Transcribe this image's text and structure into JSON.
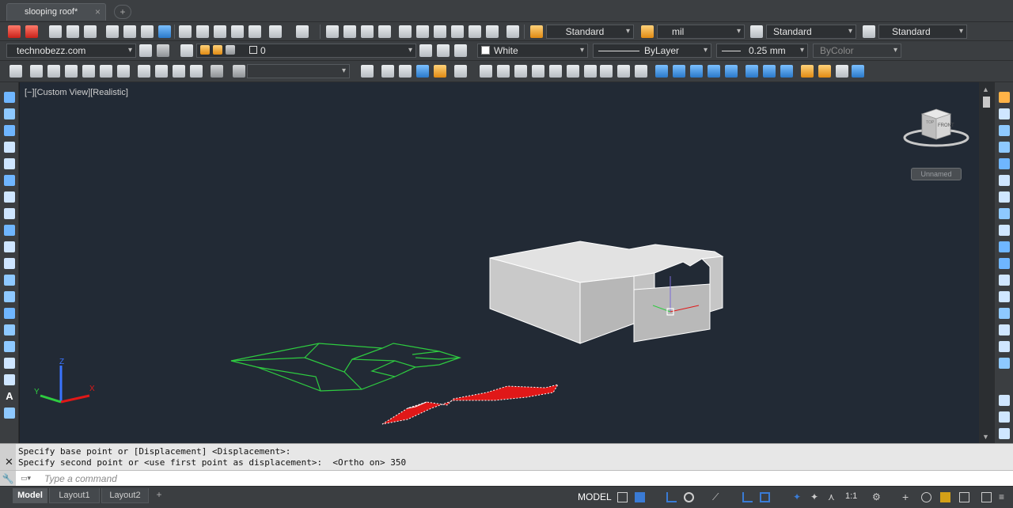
{
  "document": {
    "tab_title": "slooping roof*",
    "close_glyph": "×",
    "new_tab_glyph": "+"
  },
  "toolbar1": {
    "text_style": "Standard",
    "dim_style": "mil",
    "table_style": "Standard",
    "mleader_style": "Standard"
  },
  "toolbar2": {
    "workspace": "technobezz.com",
    "layer": "0",
    "color": "White",
    "linetype": "ByLayer",
    "lineweight": "0.25 mm",
    "plotstyle": "ByColor"
  },
  "viewport": {
    "label": "[−][Custom View][Realistic]",
    "viewcube_front": "FRONT",
    "viewcube_top": "TOP",
    "ucs_badge": "Unnamed",
    "axis_x": "X",
    "axis_y": "Y",
    "axis_z": "Z"
  },
  "command": {
    "history": [
      "Specify base point or [Displacement] <Displacement>:",
      "Specify second point or <use first point as displacement>:  <Ortho on> 350"
    ],
    "placeholder": "Type a command"
  },
  "statusbar": {
    "layout_tabs": [
      "Model",
      "Layout1",
      "Layout2"
    ],
    "add_tab": "+",
    "space": "MODEL",
    "scale": "1:1"
  },
  "colors": {
    "viewport_bg": "#222a35",
    "wireframe": "#2ecc40",
    "roof_red": "#e01818",
    "solid": "#cfcfcf"
  }
}
